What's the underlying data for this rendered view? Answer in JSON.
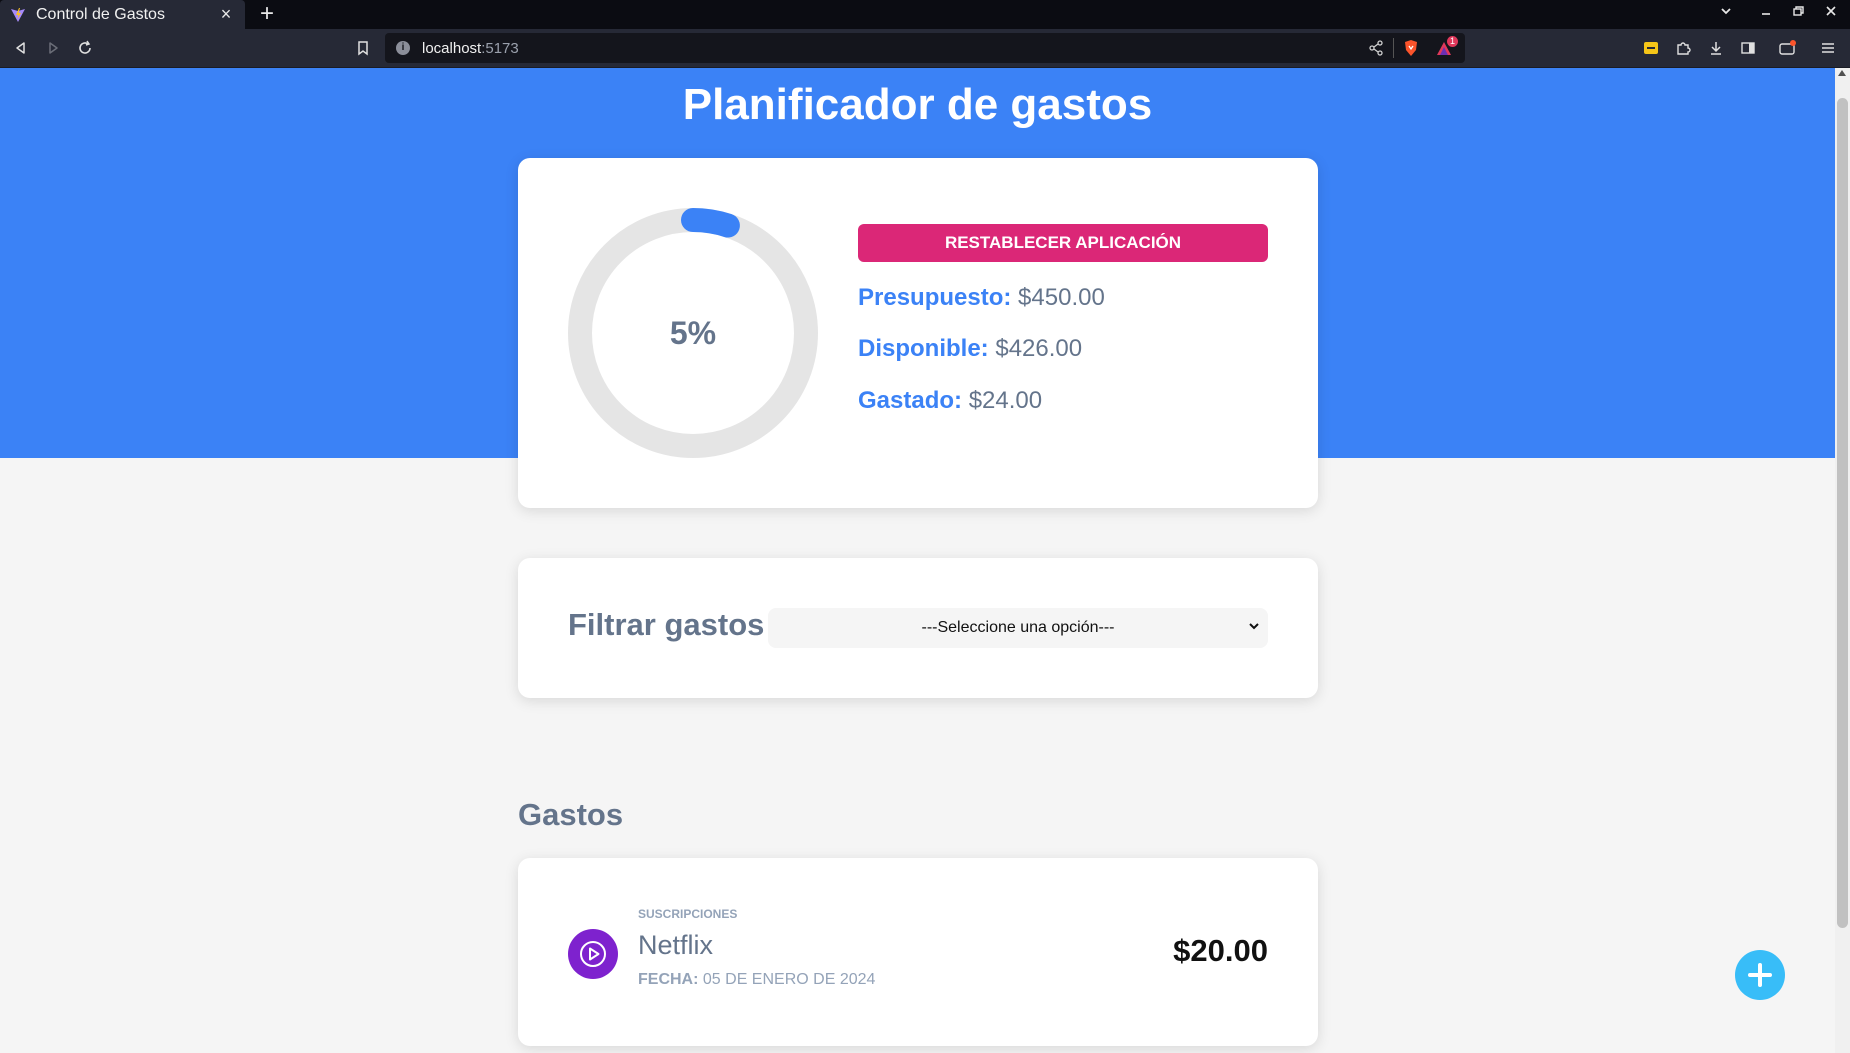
{
  "browser": {
    "tab_title": "Control de Gastos",
    "new_tab_label": "+",
    "url_host": "localhost",
    "url_port": ":5173",
    "badge_count": "1"
  },
  "app": {
    "title": "Planificador de gastos",
    "reset_label": "Restablecer aplicación",
    "progress_percent": 5,
    "progress_text": "5%",
    "stats": {
      "budget_label": "Presupuesto:",
      "budget_value": "$450.00",
      "available_label": "Disponible:",
      "available_value": "$426.00",
      "spent_label": "Gastado:",
      "spent_value": "$24.00"
    },
    "filter": {
      "label": "Filtrar gastos",
      "selected_option": "---Seleccione una opción---"
    },
    "expenses_title": "Gastos",
    "expenses": [
      {
        "category": "Suscripciones",
        "name": "Netflix",
        "date_label": "Fecha:",
        "date_value": "05 de enero de 2024",
        "amount": "$20.00",
        "icon": "play-icon"
      }
    ],
    "colors": {
      "header": "#3b82f6",
      "reset": "#db2777",
      "subscription_icon": "#7e22ce",
      "fab": "#38bdf8"
    }
  }
}
